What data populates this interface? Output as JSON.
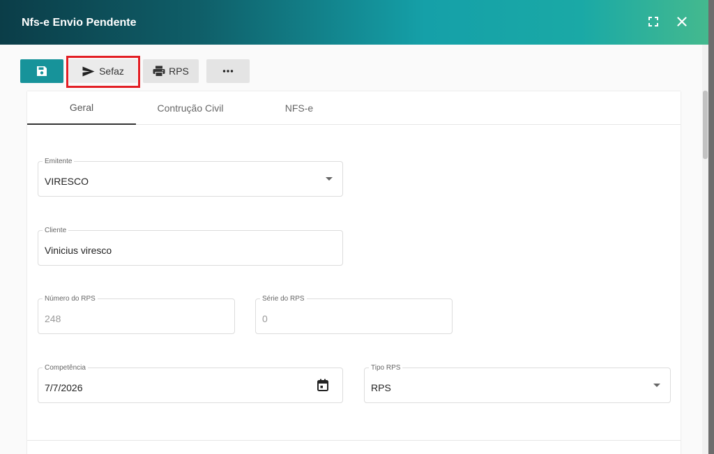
{
  "dialog": {
    "title": "Nfs-e Envio Pendente",
    "accent_color": "#17939a",
    "highlight_color": "#e31e24"
  },
  "header_icons": {
    "expand": "fullscreen-icon",
    "close": "close-icon"
  },
  "toolbar": {
    "save_icon": "floppy-disk-icon",
    "sefaz_label": "Sefaz",
    "sefaz_icon": "send-icon",
    "rps_label": "RPS",
    "rps_icon": "printer-icon",
    "more_label": "•••"
  },
  "tabs": [
    {
      "label": "Geral",
      "active": true
    },
    {
      "label": "Contrução Civil",
      "active": false
    },
    {
      "label": "NFS-e",
      "active": false
    }
  ],
  "form": {
    "emitente": {
      "label": "Emitente",
      "value": "VIRESCO"
    },
    "cliente": {
      "label": "Cliente",
      "value": "Vinicius viresco"
    },
    "numero_rps": {
      "label": "Número do RPS",
      "value": "248"
    },
    "serie_rps": {
      "label": "Série do RPS",
      "value": "0"
    },
    "competencia": {
      "label": "Competência",
      "value": "7/7/2026"
    },
    "tipo_rps": {
      "label": "Tipo RPS",
      "value": "RPS"
    }
  }
}
